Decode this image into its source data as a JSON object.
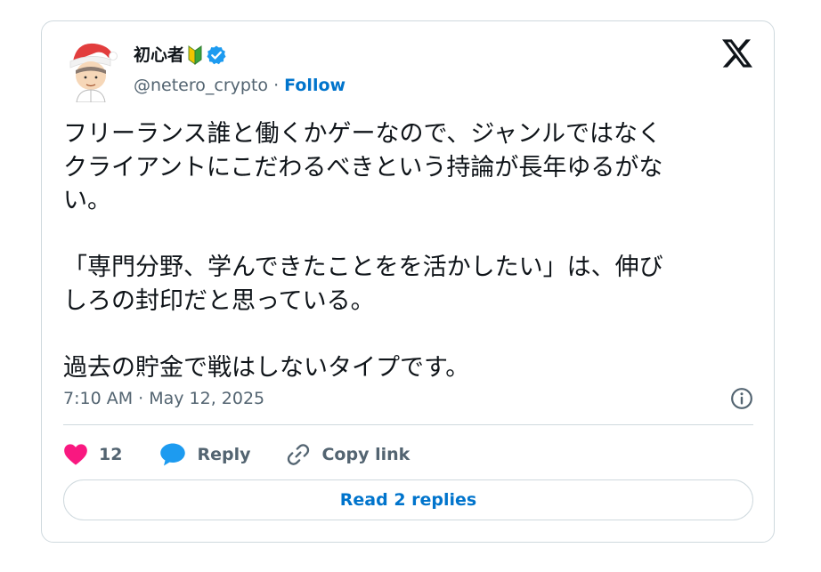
{
  "author": {
    "display_name": "初心者",
    "handle": "@netero_crypto",
    "separator": "·",
    "follow_label": "Follow",
    "verified": true
  },
  "tweet": {
    "text": "フリーランス誰と働くかゲーなので、ジャンルではなく\nクライアントにこだわるべきという持論が長年ゆるがな\nい。\n\n「専門分野、学んできたことをを活かしたい」は、伸び\nしろの封印だと思っている。\n\n過去の貯金で戦はしないタイプです。",
    "timestamp": "7:10 AM · May 12, 2025"
  },
  "actions": {
    "like_count": "12",
    "reply_label": "Reply",
    "copy_link_label": "Copy link"
  },
  "read_replies_label": "Read 2 replies",
  "colors": {
    "accent": "#0074cc",
    "like": "#f91880",
    "reply_bubble": "#1d9bf0",
    "muted": "#536471",
    "border": "#cfd9de",
    "verified": "#1d9bf0"
  },
  "icons": {
    "brand": "x-logo-icon",
    "info": "info-icon",
    "like": "heart-icon",
    "reply": "speech-bubble-icon",
    "copy": "link-icon",
    "badge": "beginner-mark-icon",
    "verified": "verified-badge-icon"
  }
}
